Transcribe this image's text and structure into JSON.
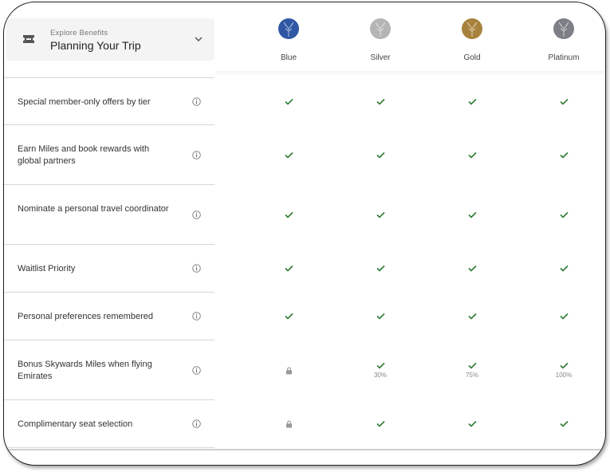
{
  "explore": {
    "small_label": "Explore Benefits",
    "title": "Planning Your Trip"
  },
  "tiers": [
    {
      "name": "Blue",
      "color": "#2f57a4"
    },
    {
      "name": "Silver",
      "color": "#b4b4b4"
    },
    {
      "name": "Gold",
      "color": "#a8823c"
    },
    {
      "name": "Platinum",
      "color": "#7d7f86"
    }
  ],
  "benefits": [
    {
      "label": "Special member-only offers by tier",
      "cells": [
        "check",
        "check",
        "check",
        "check"
      ],
      "percents": [
        "",
        "",
        "",
        ""
      ]
    },
    {
      "label": "Earn Miles and book rewards with global partners",
      "cells": [
        "check",
        "check",
        "check",
        "check"
      ],
      "percents": [
        "",
        "",
        "",
        ""
      ]
    },
    {
      "label": "Nominate a personal travel coordinator",
      "cells": [
        "check",
        "check",
        "check",
        "check"
      ],
      "percents": [
        "",
        "",
        "",
        ""
      ]
    },
    {
      "label": "Waitlist Priority",
      "cells": [
        "check",
        "check",
        "check",
        "check"
      ],
      "percents": [
        "",
        "",
        "",
        ""
      ]
    },
    {
      "label": "Personal preferences remembered",
      "cells": [
        "check",
        "check",
        "check",
        "check"
      ],
      "percents": [
        "",
        "",
        "",
        ""
      ]
    },
    {
      "label": "Bonus Skywards Miles when flying Emirates",
      "cells": [
        "lock",
        "check",
        "check",
        "check"
      ],
      "percents": [
        "",
        "30%",
        "75%",
        "100%"
      ]
    },
    {
      "label": "Complimentary seat selection",
      "cells": [
        "lock",
        "check",
        "check",
        "check"
      ],
      "percents": [
        "",
        "",
        "",
        ""
      ]
    }
  ],
  "icons": {
    "check": "check-icon",
    "lock": "lock-icon",
    "info": "info-icon",
    "ticket": "ticket-icon",
    "chevron": "chevron-down-icon"
  },
  "colors": {
    "check": "#2e7d32",
    "lock": "#999999"
  }
}
